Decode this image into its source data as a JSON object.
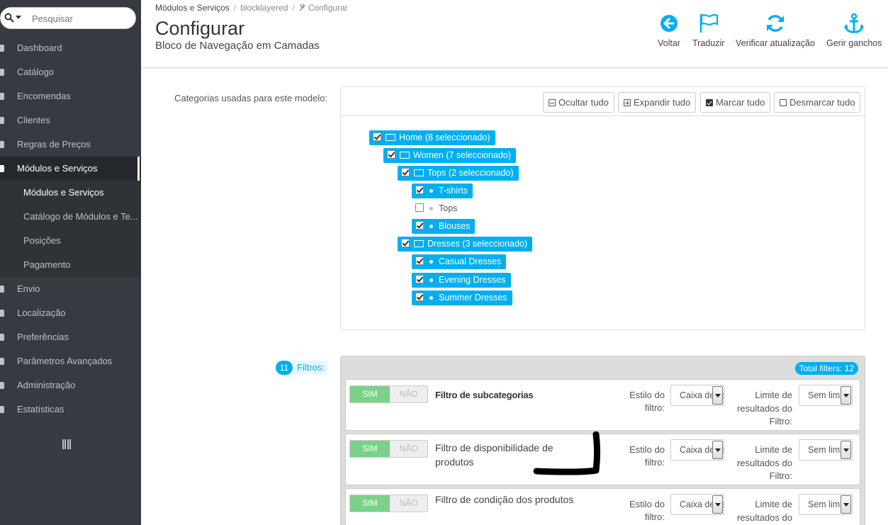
{
  "search": {
    "placeholder": "Pesquisar"
  },
  "sidebar": {
    "items": [
      {
        "label": "Dashboard"
      },
      {
        "label": "Catálogo"
      },
      {
        "label": "Encomendas"
      },
      {
        "label": "Clientes"
      },
      {
        "label": "Regras de Preços"
      },
      {
        "label": "Módulos e Serviços"
      },
      {
        "label": "Envio"
      },
      {
        "label": "Localização"
      },
      {
        "label": "Preferências"
      },
      {
        "label": "Parâmetros Avançados"
      },
      {
        "label": "Administração"
      },
      {
        "label": "Estatísticas"
      }
    ],
    "submenu": [
      {
        "label": "Módulos e Serviços"
      },
      {
        "label": "Catálogo de Módulos e Te..."
      },
      {
        "label": "Posições"
      },
      {
        "label": "Pagamento"
      }
    ]
  },
  "breadcrumb": {
    "first": "Módulos e Serviços",
    "second": "blocklayered",
    "third": "Configurar"
  },
  "header": {
    "title": "Configurar",
    "subtitle": "Bloco de Navegação em Camadas",
    "toolbar": {
      "back": "Voltar",
      "translate": "Traduzir",
      "check_update": "Verificar atualização",
      "hooks": "Gerir ganchos"
    }
  },
  "categories": {
    "label": "Categorias usadas para este modelo:",
    "buttons": {
      "collapse": "Ocultar tudo",
      "expand": "Expandir tudo",
      "check_all": "Marcar tudo",
      "uncheck_all": "Desmarcar tudo"
    },
    "tree": [
      {
        "label": "Home (8 seleccionado)",
        "checked": true,
        "folder": true
      },
      {
        "label": "Women (7 seleccionado)",
        "checked": true,
        "folder": true
      },
      {
        "label": "Tops (2 seleccionado)",
        "checked": true,
        "folder": true
      },
      {
        "label": "T-shirts",
        "checked": true,
        "folder": false
      },
      {
        "label": "Tops",
        "checked": false,
        "folder": false
      },
      {
        "label": "Blouses",
        "checked": true,
        "folder": false
      },
      {
        "label": "Dresses (3 seleccionado)",
        "checked": true,
        "folder": true
      },
      {
        "label": "Casual Dresses",
        "checked": true,
        "folder": false
      },
      {
        "label": "Evening Dresses",
        "checked": true,
        "folder": false
      },
      {
        "label": "Summer Dresses",
        "checked": true,
        "folder": false
      }
    ]
  },
  "filters": {
    "count": "11",
    "label": "Filtros:",
    "total": "Total filters: 12",
    "switch_yes": "SIM",
    "switch_no": "NÃO",
    "style_label": "Estilo do filtro:",
    "limit_label": "Limite de resultados do Filtro:",
    "rows": [
      {
        "name": "Filtro de subcategorias",
        "style": "Caixa de verificação",
        "limit": "Sem limite"
      },
      {
        "name": "Filtro de disponibilidade de produtos",
        "style": "Caixa de verificação",
        "limit": "Sem limite"
      },
      {
        "name": "Filtro de condição dos produtos",
        "style": "Caixa de verificação",
        "limit": "Sem limite"
      }
    ]
  },
  "colors": {
    "accent": "#00aff0",
    "sidebar_bg": "#363a41",
    "switch_on": "#7bd18a"
  }
}
